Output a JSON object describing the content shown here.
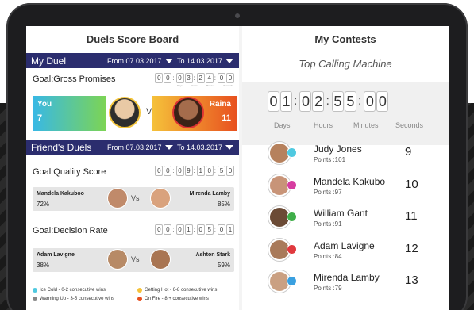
{
  "left_panel": {
    "title": "Duels Score Board",
    "my_duel": {
      "label": "My Duel",
      "from": "From 07.03.2017",
      "to": "To 14.03.2017",
      "goal": "Goal:Gross Promises",
      "timer": [
        "0",
        "0",
        ":",
        "0",
        "3",
        ":",
        "2",
        "4",
        ":",
        "0",
        "0"
      ],
      "timer_labels": [
        "Days",
        "Hours",
        "Minutes",
        "Seconds"
      ],
      "you_label": "You",
      "you_score": "7",
      "vs": "Vs",
      "opponent_label": "Raina",
      "opponent_score": "11"
    },
    "friends_duels": {
      "label": "Friend's Duels",
      "from": "From 07.03.2017",
      "to": "To 14.03.2017",
      "duels": [
        {
          "goal": "Goal:Quality Score",
          "timer": [
            "0",
            "0",
            ":",
            "0",
            "9",
            ":",
            "1",
            "0",
            ":",
            "5",
            "0"
          ],
          "left_name": "Mandela Kakuboo",
          "left_score": "72%",
          "right_name": "Mirenda Lamby",
          "right_score": "85%",
          "vs": "Vs"
        },
        {
          "goal": "Goal:Decision Rate",
          "timer": [
            "0",
            "0",
            ":",
            "0",
            "1",
            ":",
            "0",
            "5",
            ":",
            "0",
            "1"
          ],
          "left_name": "Adam Lavigne",
          "left_score": "38%",
          "right_name": "Ashton Stark",
          "right_score": "59%",
          "vs": "Vs"
        }
      ]
    },
    "legend": [
      {
        "text": "Ice Cold - 0-2 consecutive wins",
        "color": "#4fc9e0"
      },
      {
        "text": "Getting Hot - 6-8 consecutive wins",
        "color": "#f5c23a"
      },
      {
        "text": "Warming Up - 3-5 consecutive wins",
        "color": "#888888"
      },
      {
        "text": "On Fire - 8 + consecutive wins",
        "color": "#e8501f"
      }
    ]
  },
  "right_panel": {
    "title": "My Contests",
    "subtitle": "Top Calling Machine",
    "timer": [
      "0",
      "1",
      ":",
      "0",
      "2",
      ":",
      "5",
      "5",
      ":",
      "0",
      "0"
    ],
    "timer_labels": [
      "Days",
      "Hours",
      "Minutes",
      "Seconds"
    ],
    "leaderboard": [
      {
        "name": "Judy Jones",
        "points": "Points :101",
        "rank": "9",
        "badge_color": "#4fc9e0"
      },
      {
        "name": "Mandela Kakubo",
        "points": "Points :97",
        "rank": "10",
        "badge_color": "#d63da0"
      },
      {
        "name": "William Gant",
        "points": "Points :91",
        "rank": "11",
        "badge_color": "#3fae49"
      },
      {
        "name": "Adam Lavigne",
        "points": "Points :84",
        "rank": "12",
        "badge_color": "#e0393e"
      },
      {
        "name": "Mirenda Lamby",
        "points": "Points :79",
        "rank": "13",
        "badge_color": "#3aa0e0"
      }
    ]
  },
  "colors": {
    "header_bar": "#2b2d6e",
    "accent_blue": "#38b8e6",
    "accent_orange": "#e8501f"
  }
}
